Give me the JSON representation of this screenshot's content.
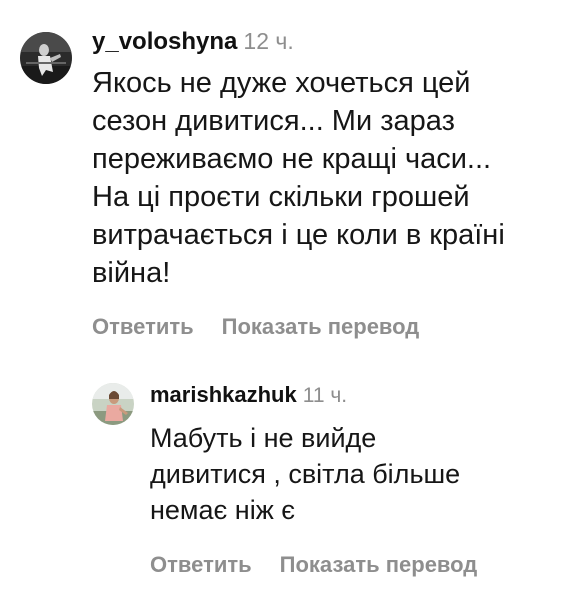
{
  "comments": [
    {
      "username": "y_voloshyna",
      "time": "12 ч.",
      "text_lines": [
        "Якось не дуже хочеться цей",
        "сезон дивитися... Ми зараз",
        "переживаємо не кращі часи...",
        "На ці проєти скільки грошей",
        "витрачається і це коли в країні",
        "війна!"
      ],
      "actions": {
        "reply": "Ответить",
        "translate": "Показать перевод"
      }
    },
    {
      "username": "marishkazhuk",
      "time": "11 ч.",
      "text_lines": [
        "Мабуть і не вийде",
        "дивитися , світла більше",
        "немає ніж є"
      ],
      "actions": {
        "reply": "Ответить",
        "translate": "Показать перевод"
      }
    }
  ],
  "colors": {
    "text": "#161616",
    "secondary": "#8e8e8e",
    "background": "#ffffff"
  }
}
